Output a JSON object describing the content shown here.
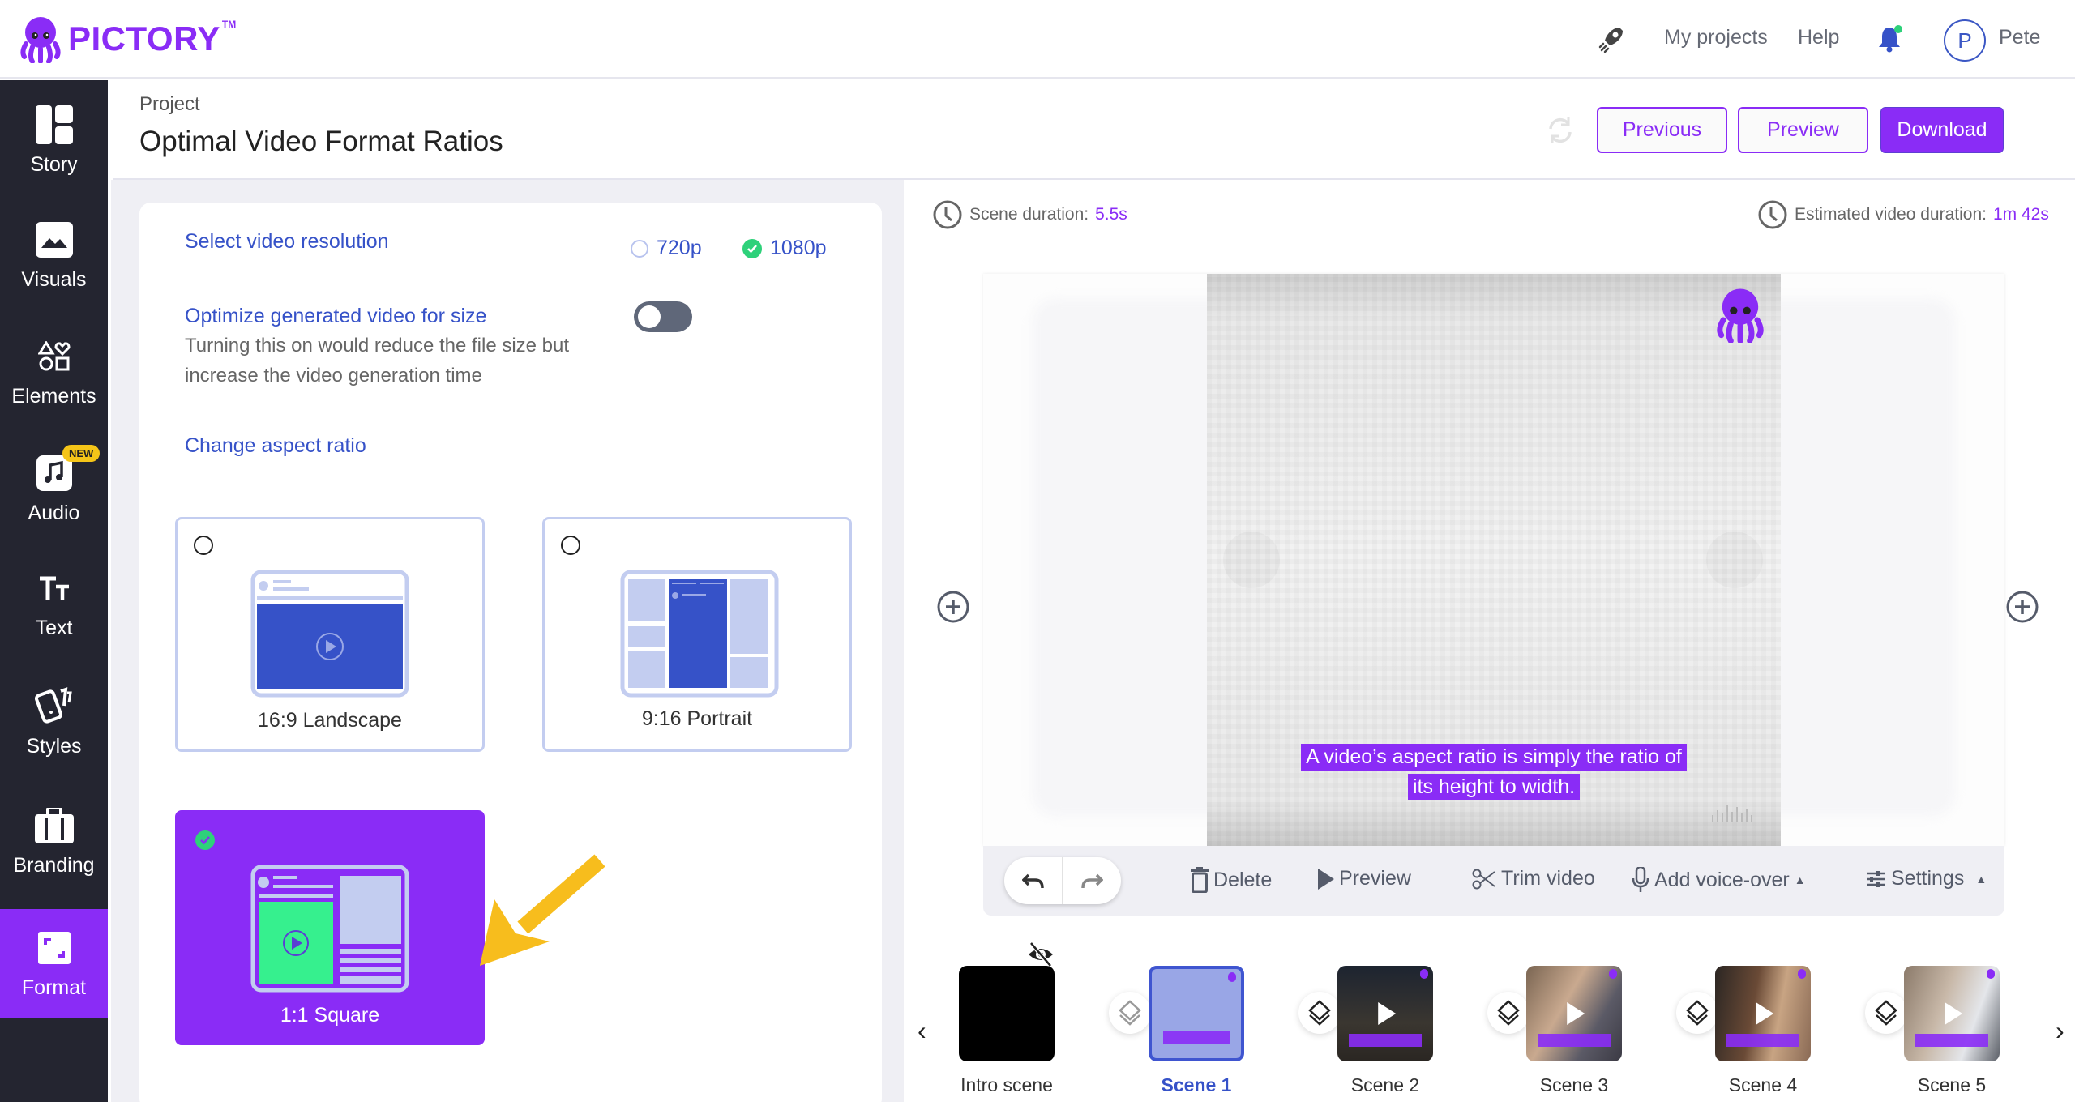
{
  "app": {
    "brand": "PICTORY",
    "trademark": "TM"
  },
  "topnav": {
    "my_projects": "My projects",
    "help": "Help",
    "user_initial": "P",
    "user_name": "Pete"
  },
  "sidebar": {
    "items": [
      {
        "label": "Story",
        "icon": "layout-icon"
      },
      {
        "label": "Visuals",
        "icon": "image-icon"
      },
      {
        "label": "Elements",
        "icon": "shapes-icon"
      },
      {
        "label": "Audio",
        "icon": "music-icon",
        "badge": "NEW"
      },
      {
        "label": "Text",
        "icon": "text-icon"
      },
      {
        "label": "Styles",
        "icon": "cards-icon"
      },
      {
        "label": "Branding",
        "icon": "briefcase-icon"
      },
      {
        "label": "Format",
        "icon": "format-icon",
        "active": true
      }
    ]
  },
  "header": {
    "project_label": "Project",
    "project_title": "Optimal Video Format Ratios",
    "previous_label": "Previous",
    "preview_label": "Preview",
    "download_label": "Download"
  },
  "format_panel": {
    "resolution_label": "Select video resolution",
    "resolution_options": [
      {
        "label": "720p",
        "selected": false
      },
      {
        "label": "1080p",
        "selected": true
      }
    ],
    "optimize_label": "Optimize generated video for size",
    "optimize_description": "Turning this on would reduce the file size but increase the video generation time",
    "optimize_enabled": false,
    "aspect_label": "Change aspect ratio",
    "aspect_options": [
      {
        "label": "16:9 Landscape",
        "selected": false
      },
      {
        "label": "9:16 Portrait",
        "selected": false
      },
      {
        "label": "1:1 Square",
        "selected": true
      }
    ]
  },
  "preview": {
    "scene_duration_label": "Scene duration:",
    "scene_duration_value": "5.5s",
    "estimated_label": "Estimated video duration:",
    "estimated_value": "1m 42s",
    "caption_lines": [
      "A video’s aspect ratio is simply the ratio of",
      "its height to width."
    ]
  },
  "toolbar": {
    "delete": "Delete",
    "preview": "Preview",
    "trim": "Trim video",
    "voiceover": "Add voice-over",
    "settings": "Settings"
  },
  "scenes": [
    {
      "label": "Intro scene",
      "active": false,
      "hidden": true
    },
    {
      "label": "Scene 1",
      "active": true
    },
    {
      "label": "Scene 2",
      "active": false
    },
    {
      "label": "Scene 3",
      "active": false
    },
    {
      "label": "Scene 4",
      "active": false
    },
    {
      "label": "Scene 5",
      "active": false
    }
  ],
  "colors": {
    "accent": "#8a2cf6",
    "link_blue": "#3652c8",
    "success": "#2ed17a",
    "sidebar_bg": "#242530",
    "annotation_arrow": "#f7bd1d"
  }
}
